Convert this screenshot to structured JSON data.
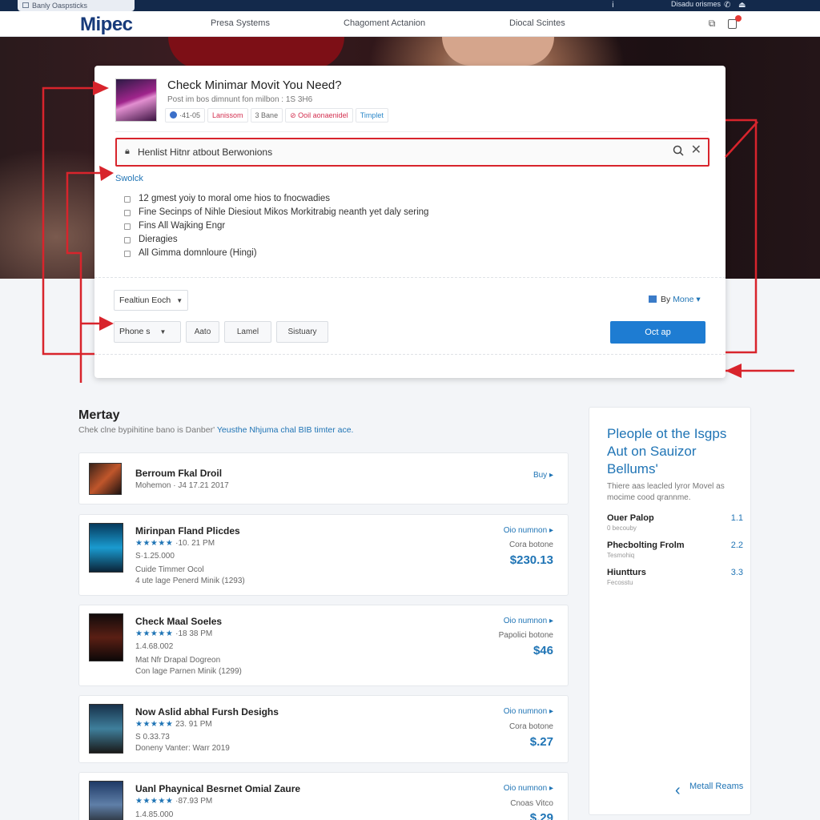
{
  "topbar": {
    "tab_label": "Banly Oaspsticks",
    "right_text": "Disadu orismes"
  },
  "nav": {
    "logo": "Mipec",
    "links": [
      "Presa Systems",
      "Chagoment Actanion",
      "Diocal Scintes"
    ]
  },
  "card": {
    "title": "Check Minimar Movit You Need?",
    "subtitle": "Post im bos dimnunt fon milbon : 1S 3H6",
    "chips": [
      "·41-05",
      "Lanissom",
      "3 Bane",
      "Ooil aonaenidel",
      "Timplet"
    ],
    "search": {
      "value": "Henlist Hitnr atbout Berwonions"
    },
    "suggestions_label": "Swolck",
    "suggestions": [
      "12 gmest yoiy to moral ome hios to fnocwadies",
      "Fine Secinps of Nihle Diesiout Mikos Morkitrabig neanth yet daly sering",
      "Fins All Wajking Engr",
      "Dieragies",
      "All Gimma domnloure (Hingi)"
    ],
    "filter_dropdown": "Fealtiun Eoch",
    "phone_dropdown": "Phone s",
    "filter_buttons": [
      "Aato",
      "Lamel",
      "Sistuary"
    ],
    "sort_label": "By",
    "sort_value": "Mone",
    "primary_button": "Oct ap"
  },
  "section": {
    "title": "Mertay",
    "subtitle_plain": "Chek clne bypihitine bano is Danber'",
    "subtitle_link": "Yeusthe Nhjuma chal BIB timter ace."
  },
  "results": [
    {
      "title": "Berroum Fkal Droil",
      "line1": "Mohemon · J4 17.21 2017",
      "link": "Buy"
    },
    {
      "title": "Mirinpan Fland Plicdes",
      "stars": "★★★★★",
      "rating": "·10. 21 PM",
      "line2": "S·1.25.000",
      "line3": "Cuide Timmer Ocol",
      "line4": "4 ute lage Penerd Minik (1293)",
      "link": "Oio numnon",
      "label": "Cora botone",
      "price": "$230.13"
    },
    {
      "title": "Check Maal Soeles",
      "stars": "★★★★★",
      "rating": "·18 38 PM",
      "line2": "1.4.68.002",
      "line3": "Mat Nfr Drapal Dogreon",
      "line4": "Con lage Parnen Minik (1299)",
      "link": "Oio numnon",
      "label": "Papolici botone",
      "price": "$46"
    },
    {
      "title": "Now Aslid abhal Fursh Desighs",
      "stars": "★★★★★",
      "rating": "23. 91 PM",
      "line2": "S 0.33.73",
      "line3": "Doneny Vanter: Warr 2019",
      "link": "Oio numnon",
      "label": "Cora botone",
      "price": "$.27"
    },
    {
      "title": "Uanl Phaynical Besrnet Omial Zaure",
      "stars": "★★★★★",
      "rating": "·87.93 PM",
      "line2": "1.4.85.000",
      "link": "Oio numnon",
      "label": "Cnoas Vitco",
      "price": "$.29"
    }
  ],
  "panel": {
    "title": "Pleople ot the Isgps Aut on Sauizor Bellums'",
    "desc": "Thiere aas leacled lyror Movel as mocime cood qrannme.",
    "items": [
      {
        "name": "Ouer Palop",
        "sub": "0 becouby",
        "value": "1.1"
      },
      {
        "name": "Phecbolting Frolm",
        "sub": "Tesmohiq",
        "value": "2.2"
      },
      {
        "name": "Hiuntturs",
        "sub": "Fecosstu",
        "value": "3.3"
      }
    ],
    "more": "Metall Reams"
  },
  "colors": {
    "brand": "#173a7a",
    "accent": "#1e7cd2",
    "annotation": "#d8242c"
  },
  "icons": [
    "search-icon",
    "close-icon",
    "bookmark-icon",
    "cart-icon",
    "phone-icon",
    "user-icon",
    "play-icon",
    "chevron-left-icon"
  ]
}
